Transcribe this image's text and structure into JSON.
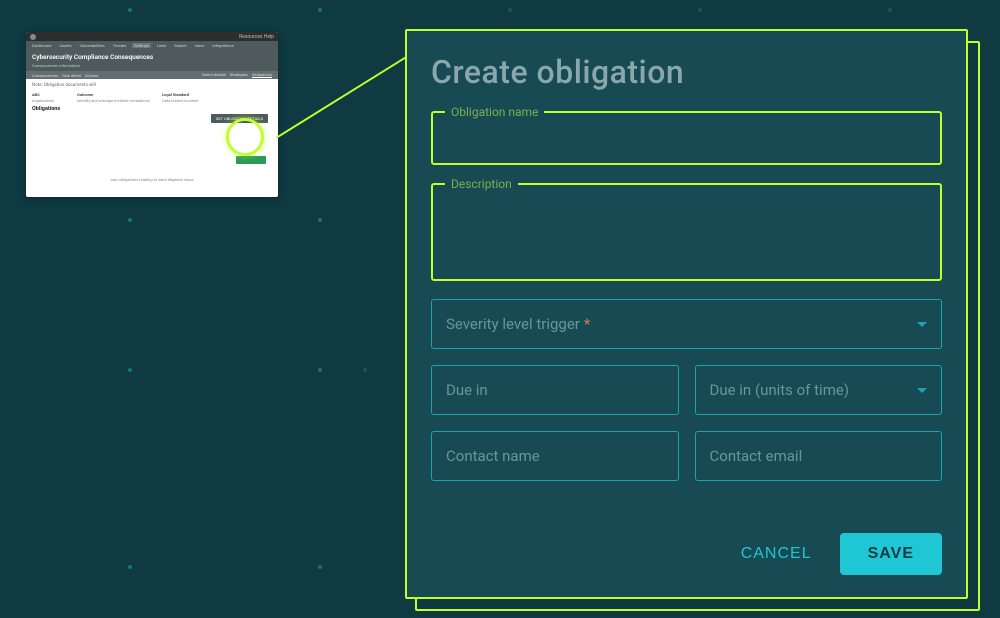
{
  "modal": {
    "title": "Create obligation",
    "obligation_name_label": "Obligation name",
    "obligation_name_value": "",
    "description_label": "Description",
    "description_value": "",
    "severity_label": "Severity level trigger",
    "severity_required_marker": "*",
    "due_in_placeholder": "Due in",
    "due_in_value": "",
    "due_units_label": "Due in (units of time)",
    "contact_name_placeholder": "Contact name",
    "contact_name_value": "",
    "contact_email_placeholder": "Contact email",
    "contact_email_value": "",
    "cancel_label": "CANCEL",
    "save_label": "SAVE"
  },
  "thumb": {
    "top_menu_right": "Resources   Help",
    "title": "Cybersecurity Compliance Consequences",
    "subtitle": "Consequences information",
    "tabs": [
      "Dashboard",
      "Assets",
      "Vulnerabilities",
      "Threats",
      "Settings",
      "Links",
      "Search",
      "Inbox",
      "Integrations"
    ],
    "subtabs_left": [
      "Consequences",
      "Risk detail",
      "Actions"
    ],
    "subtabs_right": [
      "Select details",
      "Strategies",
      "Obligations"
    ],
    "note": "Note: Obligation documents will",
    "col1_head": "ABC",
    "col1_sub": "organization",
    "col2_head": "Outcome",
    "col2_sub": "Identify and manage incident escalations",
    "col3_head": "Legal Standard",
    "col3_sub": "Data breach incident",
    "top_button": "SET OBLIGATION DETAILS",
    "section": "Obligations",
    "hint": "Add obligations relating to each litigation issue"
  }
}
